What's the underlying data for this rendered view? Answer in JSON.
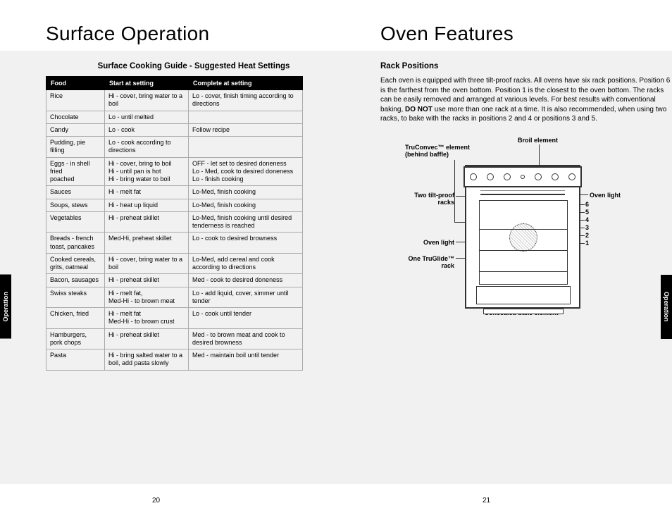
{
  "left": {
    "title": "Surface Operation",
    "subtitle": "Surface Cooking Guide - Suggested Heat Settings",
    "headers": [
      "Food",
      "Start at setting",
      "Complete at setting"
    ],
    "rows": [
      [
        "Rice",
        "Hi - cover, bring water to a boil",
        "Lo - cover, finish timing according to directions"
      ],
      [
        "Chocolate",
        "Lo - until melted",
        ""
      ],
      [
        "Candy",
        "Lo - cook",
        "Follow recipe"
      ],
      [
        "Pudding, pie filling",
        "Lo - cook according to directions",
        ""
      ],
      [
        "Eggs - in shell\n        fried\n        poached",
        "Hi - cover, bring to boil\nHi - until pan is hot\nHi - bring water to boil",
        "OFF - let set to desired doneness\nLo - Med, cook to desired doneness\nLo - finish cooking"
      ],
      [
        "Sauces",
        "Hi - melt fat",
        "Lo-Med, finish cooking"
      ],
      [
        "Soups, stews",
        "Hi - heat up liquid",
        "Lo-Med, finish cooking"
      ],
      [
        "Vegetables",
        "Hi - preheat skillet",
        "Lo-Med, finish cooking until desired tenderness is reached"
      ],
      [
        "Breads - french toast, pancakes",
        "Med-Hi, preheat skillet",
        "Lo - cook to desired browness"
      ],
      [
        "Cooked cereals, grits, oatmeal",
        "Hi - cover, bring water to a boil",
        "Lo-Med, add cereal and cook according to directions"
      ],
      [
        "Bacon, sausages",
        "Hi - preheat skillet",
        "Med - cook to desired doneness"
      ],
      [
        "Swiss steaks",
        "Hi - melt fat,\nMed-Hi - to brown meat",
        "Lo - add liquid, cover, simmer until tender"
      ],
      [
        "Chicken, fried",
        "Hi - melt fat\nMed-Hi - to brown crust",
        "Lo - cook until tender"
      ],
      [
        "Hamburgers, pork chops",
        "Hi - preheat skillet",
        "Med - to brown meat and cook to desired browness"
      ],
      [
        "Pasta",
        "Hi - bring salted water to a boil, add pasta slowly",
        "Med - maintain boil until tender"
      ]
    ],
    "pageNum": "20"
  },
  "right": {
    "title": "Oven Features",
    "subtitle": "Rack Positions",
    "para1": "Each oven is equipped with three tilt-proof racks. All ovens have six rack positions. Position 6 is the farthest from the oven bottom. Position 1 is the closest to the oven bottom. The racks can be easily removed and arranged at various levels. For best results with conventional baking, ",
    "para1_bold": "DO NOT",
    "para1_end": " use more than one rack at a time. It is also recommended, when using two racks, to bake with the racks in positions 2 and 4 or positions 3 and 5.",
    "labels": {
      "broil": "Broil element",
      "truconvec": "TruConvec™ element\n(behind baffle)",
      "tiltproof": "Two tilt-proof\nracks",
      "ovenlight": "Oven light",
      "ovenlight2": "Oven light",
      "truglide": "One TruGlide™\nrack",
      "bake": "Concealed bake element"
    },
    "rackNums": [
      "6",
      "5",
      "4",
      "3",
      "2",
      "1"
    ],
    "pageNum": "21"
  },
  "sideTab": "Operation"
}
